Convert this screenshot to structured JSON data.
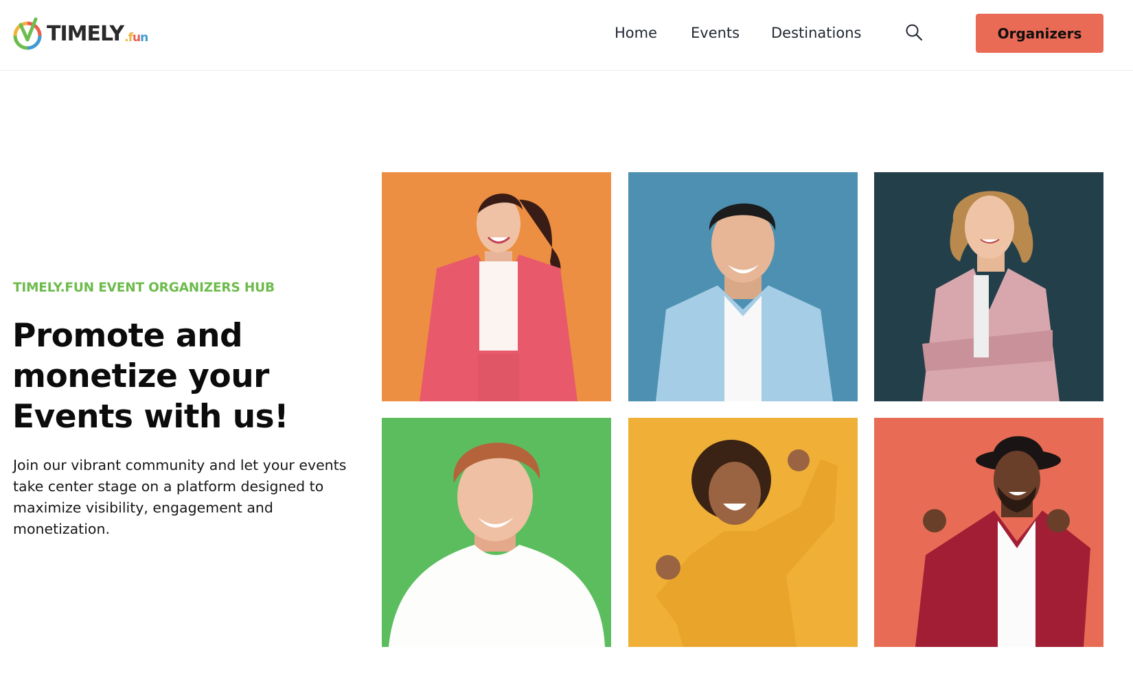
{
  "brand": {
    "name_main": "TIMELY",
    "name_sub": ".fun",
    "colors": {
      "orange": "#f0b23a",
      "red": "#e95d4f",
      "blue": "#3f9bd3",
      "green": "#6cbd4e"
    }
  },
  "nav": {
    "items": [
      {
        "label": "Home"
      },
      {
        "label": "Events"
      },
      {
        "label": "Destinations"
      }
    ],
    "search_icon": "search-icon",
    "cta_label": "Organizers",
    "cta_color": "#e96a55"
  },
  "hero": {
    "eyebrow": "TIMELY.FUN EVENT ORGANIZERS HUB",
    "headline_lines": [
      "Promote and",
      "monetize your",
      "Events with us!"
    ],
    "lede_lines": [
      "Join our vibrant community and let your events",
      "take center stage on a platform designed to",
      "maximize visibility, engagement and",
      "monetization."
    ],
    "accent_color": "#6dbb4c"
  },
  "gallery": {
    "tiles": [
      {
        "name": "woman-pink-blazer",
        "background": "#ed8f42"
      },
      {
        "name": "man-denim-shirt",
        "background": "#4d90b1"
      },
      {
        "name": "woman-checked-jacket",
        "background": "#233f4a"
      },
      {
        "name": "redhead-man-white-tee",
        "background": "#5cbd5f"
      },
      {
        "name": "woman-yellow-sweater",
        "background": "#f0b037"
      },
      {
        "name": "man-hat-red-blazer",
        "background": "#e86c55"
      }
    ]
  }
}
